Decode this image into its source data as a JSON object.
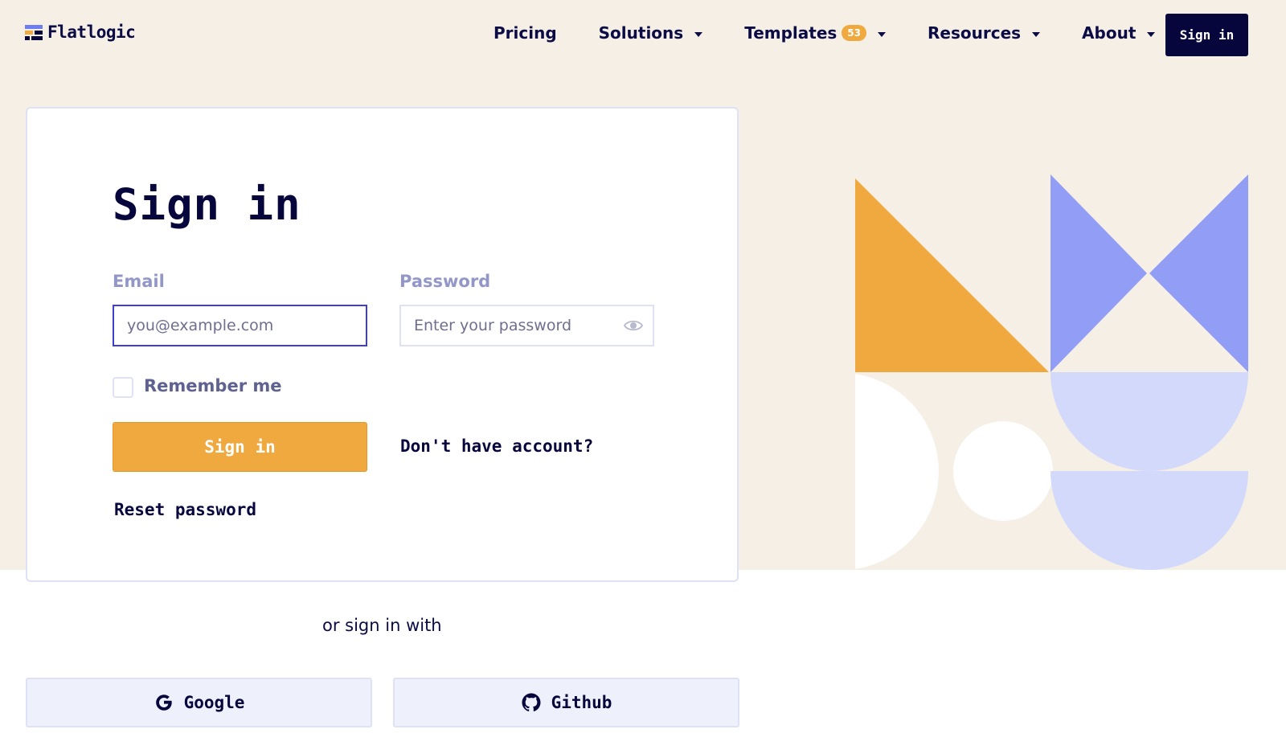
{
  "brand": {
    "name": "Flatlogic",
    "colors": {
      "navy": "#07063c",
      "orange": "#f0a93e",
      "periwinkle": "#929df5",
      "lavender": "#d2d9fa",
      "cream": "#f6efe6"
    }
  },
  "nav": {
    "items": [
      {
        "label": "Pricing",
        "dropdown": false
      },
      {
        "label": "Solutions",
        "dropdown": true
      },
      {
        "label": "Templates",
        "badge": "53",
        "dropdown": true
      },
      {
        "label": "Resources",
        "dropdown": true
      },
      {
        "label": "About",
        "dropdown": true
      }
    ],
    "signin_label": "Sign in"
  },
  "form": {
    "title": "Sign in",
    "email_label": "Email",
    "email_placeholder": "you@example.com",
    "password_label": "Password",
    "password_placeholder": "Enter your password",
    "password_toggle_icon": "eye-icon",
    "remember_label": "Remember me",
    "remember_checked": false,
    "submit_label": "Sign in",
    "signup_link": "Don't have account?",
    "reset_link": "Reset password"
  },
  "social": {
    "divider_text": "or sign in with",
    "google_label": "Google",
    "google_icon": "google-icon",
    "github_label": "Github",
    "github_icon": "github-icon"
  }
}
